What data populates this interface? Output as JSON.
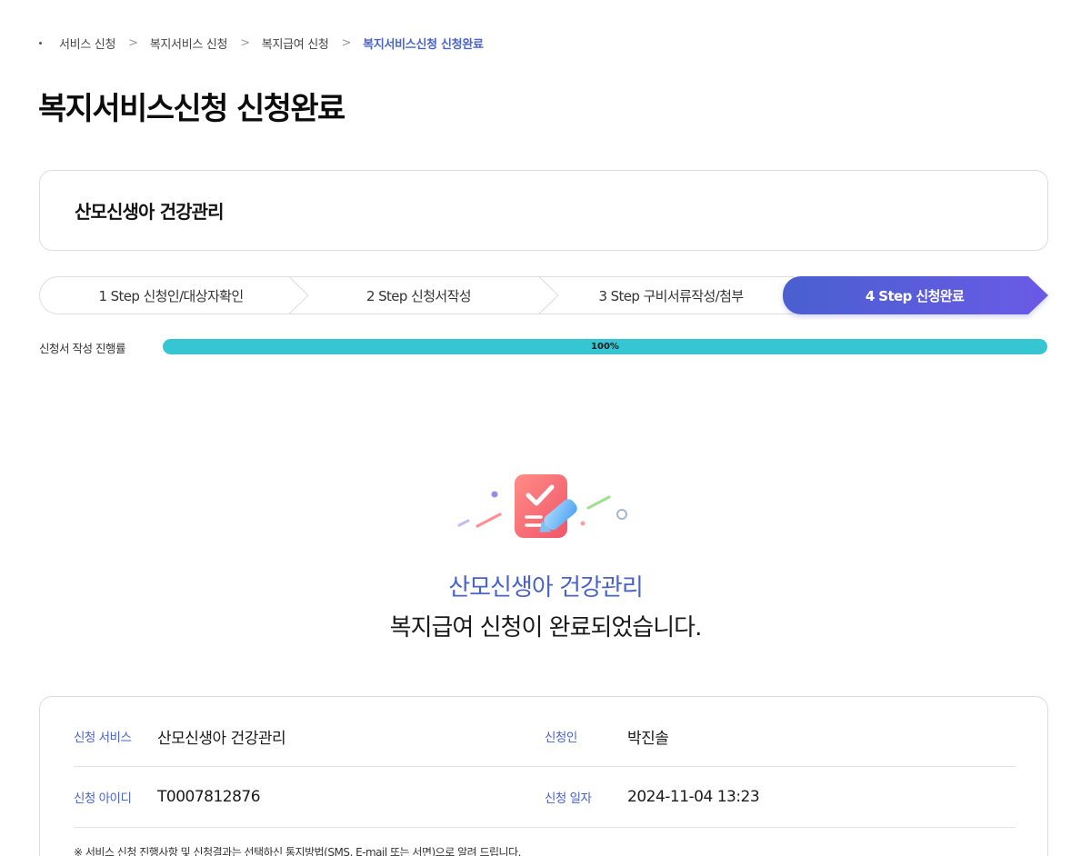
{
  "breadcrumb": {
    "items": [
      "서비스 신청",
      "복지서비스 신청",
      "복지급여 신청"
    ],
    "current": "복지서비스신청 신청완료"
  },
  "page_title": "복지서비스신청 신청완료",
  "service_name": "산모신생아 건강관리",
  "steps": [
    {
      "label": "1 Step 신청인/대상자확인",
      "active": false
    },
    {
      "label": "2 Step 신청서작성",
      "active": false
    },
    {
      "label": "3 Step 구비서류작성/첨부",
      "active": false
    },
    {
      "label": "4 Step 신청완료",
      "active": true
    }
  ],
  "progress": {
    "label": "신청서 작성 진행률",
    "value": 100,
    "text": "100%"
  },
  "completion": {
    "service": "산모신생아 건강관리",
    "message": "복지급여 신청이 완료되었습니다."
  },
  "info": {
    "service_label": "신청 서비스",
    "service_value": "산모신생아 건강관리",
    "applicant_label": "신청인",
    "applicant_value": "박진솔",
    "id_label": "신청 아이디",
    "id_value": "T0007812876",
    "date_label": "신청 일자",
    "date_value": "2024-11-04 13:23",
    "notice": "※ 서비스 신청 진행사항 및 신청결과는 선택하신 통지방법(SMS, E-mail 또는 서면)으로 알려 드립니다."
  },
  "colors": {
    "accent": "#4a63c9",
    "progress": "#36c5d3",
    "step_active_start": "#4a5fd0",
    "step_active_end": "#6a5ae6"
  },
  "icons": [
    "checklist-pencil-icon"
  ]
}
